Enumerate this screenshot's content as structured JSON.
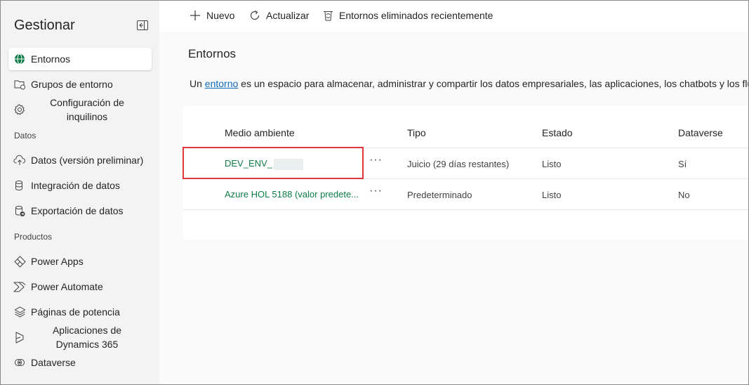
{
  "sidebar": {
    "title": "Gestionar",
    "items": [
      {
        "label": "Entornos",
        "icon": "globe-icon",
        "active": true
      },
      {
        "label": "Grupos de entorno",
        "icon": "folder-group-icon"
      },
      {
        "label": "Configuración de inquilinos",
        "icon": "gear-icon"
      }
    ],
    "sections": [
      {
        "title": "Datos",
        "items": [
          {
            "label": "Datos (versión preliminar)",
            "icon": "cloud-upload-icon"
          },
          {
            "label": "Integración de datos",
            "icon": "database-icon"
          },
          {
            "label": "Exportación de datos",
            "icon": "database-export-icon"
          }
        ]
      },
      {
        "title": "Productos",
        "items": [
          {
            "label": "Power Apps",
            "icon": "power-apps-icon"
          },
          {
            "label": "Power Automate",
            "icon": "power-automate-icon"
          },
          {
            "label": "Páginas de potencia",
            "icon": "power-pages-icon"
          },
          {
            "label": "Aplicaciones de Dynamics 365",
            "icon": "dynamics-icon"
          },
          {
            "label": "Dataverse",
            "icon": "dataverse-icon"
          }
        ]
      }
    ]
  },
  "toolbar": {
    "new_label": "Nuevo",
    "refresh_label": "Actualizar",
    "deleted_label": "Entornos eliminados recientemente"
  },
  "main": {
    "title": "Entornos",
    "intro_prefix": "Un ",
    "intro_link": "entorno",
    "intro_suffix": " es un espacio para almacenar, administrar y compartir los datos empresariales, las aplicaciones, los chatbots y los flujos"
  },
  "table": {
    "columns": [
      "Medio ambiente",
      "Tipo",
      "Estado",
      "Dataverse"
    ],
    "rows": [
      {
        "name": "DEV_ENV_",
        "type": "Juicio (29 días restantes)",
        "state": "Listo",
        "dataverse": "Sí",
        "more": "···"
      },
      {
        "name": "Azure HOL 5188 (valor predete...",
        "type": "Predeterminado",
        "state": "Listo",
        "dataverse": "No",
        "more": "···"
      }
    ]
  },
  "colors": {
    "accent_green": "#0e7c47",
    "link_blue": "#0f6cbd",
    "highlight_red": "#e0383b"
  }
}
